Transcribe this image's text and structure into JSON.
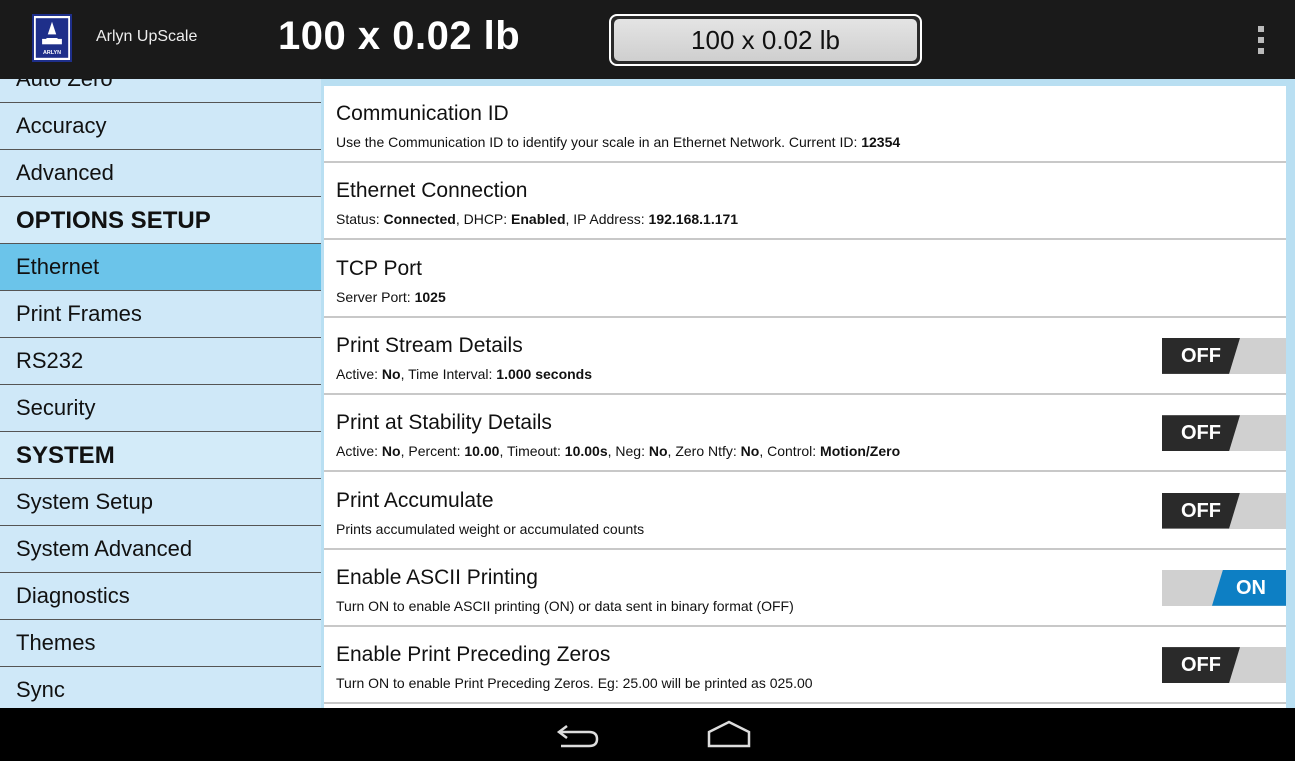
{
  "app": {
    "name": "Arlyn UpScale",
    "logo_text": "ARLYN",
    "weight_display": "100 x 0.02 lb",
    "weight_button": "100 x 0.02 lb"
  },
  "sidebar": {
    "items": [
      {
        "type": "item",
        "label": "Auto Zero"
      },
      {
        "type": "item",
        "label": "Accuracy"
      },
      {
        "type": "item",
        "label": "Advanced"
      },
      {
        "type": "header",
        "label": "OPTIONS SETUP"
      },
      {
        "type": "item",
        "label": "Ethernet",
        "active": true
      },
      {
        "type": "item",
        "label": "Print Frames"
      },
      {
        "type": "item",
        "label": "RS232"
      },
      {
        "type": "item",
        "label": "Security"
      },
      {
        "type": "header",
        "label": "SYSTEM"
      },
      {
        "type": "item",
        "label": "System Setup"
      },
      {
        "type": "item",
        "label": "System Advanced"
      },
      {
        "type": "item",
        "label": "Diagnostics"
      },
      {
        "type": "item",
        "label": "Themes"
      },
      {
        "type": "item",
        "label": "Sync"
      }
    ]
  },
  "settings": {
    "rows": [
      {
        "title": "Communication ID",
        "subtitle": [
          {
            "text": "Use the Communication ID to identify your scale in an Ethernet Network. Current ID: ",
            "bold": false
          },
          {
            "text": "12354",
            "bold": true
          }
        ],
        "toggle": null
      },
      {
        "title": "Ethernet Connection",
        "subtitle": [
          {
            "text": "Status: ",
            "bold": false
          },
          {
            "text": "Connected",
            "bold": true
          },
          {
            "text": ", DHCP: ",
            "bold": false
          },
          {
            "text": "Enabled",
            "bold": true
          },
          {
            "text": ", IP Address: ",
            "bold": false
          },
          {
            "text": "192.168.1.171",
            "bold": true
          }
        ],
        "toggle": null
      },
      {
        "title": "TCP Port",
        "subtitle": [
          {
            "text": "Server Port: ",
            "bold": false
          },
          {
            "text": "1025",
            "bold": true
          }
        ],
        "toggle": null
      },
      {
        "title": "Print Stream Details",
        "subtitle": [
          {
            "text": "Active: ",
            "bold": false
          },
          {
            "text": "No",
            "bold": true
          },
          {
            "text": ", Time Interval: ",
            "bold": false
          },
          {
            "text": "1.000 seconds",
            "bold": true
          }
        ],
        "toggle": "OFF"
      },
      {
        "title": "Print at Stability Details",
        "subtitle": [
          {
            "text": "Active: ",
            "bold": false
          },
          {
            "text": "No",
            "bold": true
          },
          {
            "text": ", Percent: ",
            "bold": false
          },
          {
            "text": "10.00",
            "bold": true
          },
          {
            "text": ", Timeout: ",
            "bold": false
          },
          {
            "text": "10.00s",
            "bold": true
          },
          {
            "text": ", Neg: ",
            "bold": false
          },
          {
            "text": "No",
            "bold": true
          },
          {
            "text": ", Zero Ntfy: ",
            "bold": false
          },
          {
            "text": "No",
            "bold": true
          },
          {
            "text": ", Control: ",
            "bold": false
          },
          {
            "text": "Motion/Zero",
            "bold": true
          }
        ],
        "toggle": "OFF"
      },
      {
        "title": "Print Accumulate",
        "subtitle": [
          {
            "text": "Prints accumulated weight or accumulated counts",
            "bold": false
          }
        ],
        "toggle": "OFF"
      },
      {
        "title": "Enable ASCII Printing",
        "subtitle": [
          {
            "text": "Turn ON to enable ASCII printing (ON) or data sent in binary format (OFF)",
            "bold": false
          }
        ],
        "toggle": "ON"
      },
      {
        "title": "Enable Print Preceding Zeros",
        "subtitle": [
          {
            "text": "Turn ON to enable Print Preceding Zeros. Eg: 25.00 will be printed as 025.00",
            "bold": false
          }
        ],
        "toggle": "OFF"
      }
    ]
  },
  "navbar": {
    "icons": [
      "back-icon",
      "home-icon"
    ]
  },
  "colors": {
    "actionbar": "#1a1a1a",
    "sidebar_bg": "#d3ebf9",
    "sidebar_active": "#6bc4ea",
    "toggle_on": "#0d7fc4",
    "toggle_off": "#2a2a2a"
  }
}
